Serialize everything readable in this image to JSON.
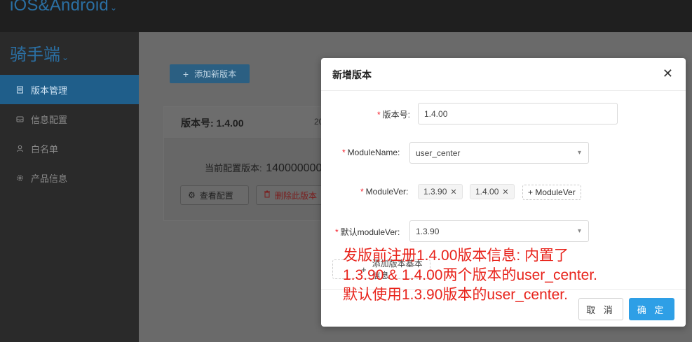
{
  "topbar": {
    "brand": "iOS&Android"
  },
  "sidebar": {
    "system_title": "骑手端",
    "items": [
      {
        "label": "版本管理",
        "icon": "document-icon",
        "active": true
      },
      {
        "label": "信息配置",
        "icon": "inbox-icon",
        "active": false
      },
      {
        "label": "白名单",
        "icon": "user-icon",
        "active": false
      },
      {
        "label": "产品信息",
        "icon": "gear-icon",
        "active": false
      }
    ]
  },
  "main": {
    "add_version_label": "添加新版本",
    "card": {
      "title": "版本号: 1.4.00",
      "date_partial": "20",
      "current_config_label": "当前配置版本:",
      "current_config_value": "140000000",
      "view_config_label": "查看配置",
      "delete_label": "删除此版本"
    }
  },
  "modal": {
    "title": "新增版本",
    "fields": {
      "version": {
        "label": "版本号:",
        "value": "1.4.00"
      },
      "module_name": {
        "label": "ModuleName:",
        "value": "user_center"
      },
      "module_ver": {
        "label": "ModuleVer:",
        "tags": [
          "1.3.90",
          "1.4.00"
        ],
        "add_label": "+ ModuleVer"
      },
      "default_module_ver": {
        "label": "默认moduleVer:",
        "value": "1.3.90"
      }
    },
    "add_basic_info_label": "添加版本基本信息",
    "cancel_label": "取 消",
    "ok_label": "确 定"
  },
  "annotation": {
    "lines": [
      "发版前注册1.4.00版本信息: 内置了",
      "1.3.90 & 1.4.00两个版本的user_center.",
      "默认使用1.3.90版本的user_center."
    ]
  },
  "colors": {
    "primary": "#2e9fe6",
    "required": "#f5222d",
    "annotation": "#e8231b",
    "sidebar_active": "#1f5e8a"
  }
}
